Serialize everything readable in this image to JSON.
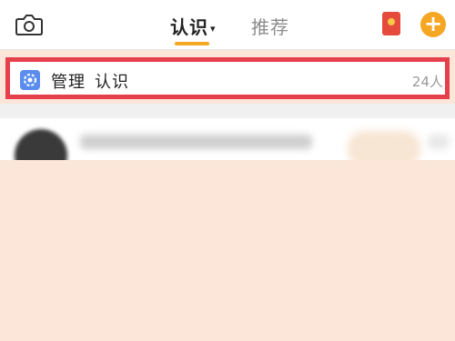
{
  "tabs": [
    {
      "label": "认识",
      "active": true
    },
    {
      "label": "推荐",
      "active": false
    }
  ],
  "group": {
    "label_1": "管理",
    "label_2": "认识",
    "count": "24人",
    "highlighted": true
  },
  "colors": {
    "accent": "#f5a623",
    "highlight_border": "#e5404b",
    "group_icon": "#5b8def"
  },
  "icons": {
    "camera": "camera-icon",
    "red_packet": "red-packet-icon",
    "add": "plus-icon",
    "group": "gear-icon"
  }
}
